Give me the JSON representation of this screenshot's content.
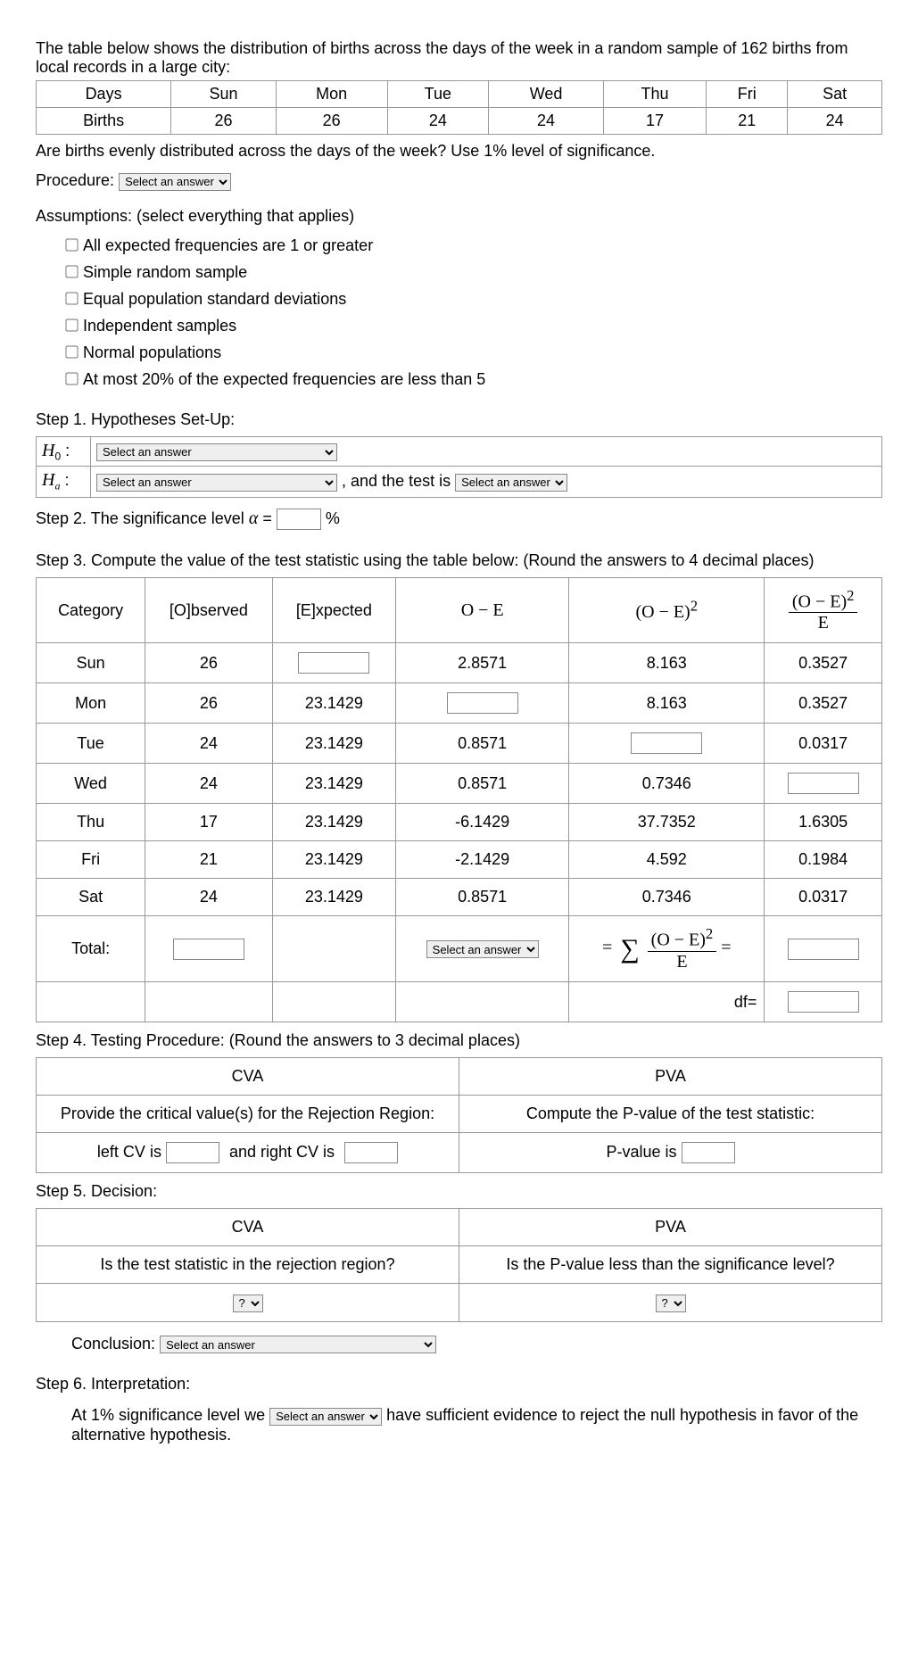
{
  "intro": "The table below shows the distribution of births across the days of the week in a random sample of 162 births from local records in a large city:",
  "data_table": {
    "row1": [
      "Days",
      "Sun",
      "Mon",
      "Tue",
      "Wed",
      "Thu",
      "Fri",
      "Sat"
    ],
    "row2": [
      "Births",
      "26",
      "26",
      "24",
      "24",
      "17",
      "21",
      "24"
    ]
  },
  "question": "Are births evenly distributed across the days of the week? Use 1% level of significance.",
  "procedure_label": "Procedure:",
  "select_placeholder": "Select an answer",
  "assumptions_label": "Assumptions: (select everything that applies)",
  "assumptions": [
    "All expected frequencies are 1 or greater",
    "Simple random sample",
    "Equal population standard deviations",
    "Independent samples",
    "Normal populations",
    "At most 20% of the expected frequencies are less than 5"
  ],
  "step1_title": "Step 1. Hypotheses Set-Up:",
  "h0_label": "H",
  "h0_sub": "0",
  "ha_sub": "a",
  "colon": ":",
  "ha_tail": ", and the test is",
  "step2_prefix": "Step 2. The significance level",
  "alpha": "α",
  "equals": "=",
  "percent": "%",
  "step3_title": "Step 3. Compute the value of the test statistic using the table below: (Round the answers to 4 decimal places)",
  "calc_headers": {
    "cat": "Category",
    "obs": "[O]bserved",
    "exp": "[E]xpected",
    "ome": "O − E",
    "omesq_num": "(O − E)",
    "sq": "2",
    "E": "E"
  },
  "calc_rows": [
    {
      "cat": "Sun",
      "obs": "26",
      "exp_input": true,
      "ome": "2.8571",
      "omesq": "8.163",
      "chi": "0.3527"
    },
    {
      "cat": "Mon",
      "obs": "26",
      "exp": "23.1429",
      "ome_input": true,
      "omesq": "8.163",
      "chi": "0.3527"
    },
    {
      "cat": "Tue",
      "obs": "24",
      "exp": "23.1429",
      "ome": "0.8571",
      "omesq_input": true,
      "chi": "0.0317"
    },
    {
      "cat": "Wed",
      "obs": "24",
      "exp": "23.1429",
      "ome": "0.8571",
      "omesq": "0.7346",
      "chi_input": true
    },
    {
      "cat": "Thu",
      "obs": "17",
      "exp": "23.1429",
      "ome": "-6.1429",
      "omesq": "37.7352",
      "chi": "1.6305"
    },
    {
      "cat": "Fri",
      "obs": "21",
      "exp": "23.1429",
      "ome": "-2.1429",
      "omesq": "4.592",
      "chi": "0.1984"
    },
    {
      "cat": "Sat",
      "obs": "24",
      "exp": "23.1429",
      "ome": "0.8571",
      "omesq": "0.7346",
      "chi": "0.0317"
    }
  ],
  "total_label": "Total:",
  "df_label": "df=",
  "step4_title": "Step 4. Testing Procedure: (Round the answers to 3 decimal places)",
  "cva": "CVA",
  "pva": "PVA",
  "cva_desc": "Provide the critical value(s) for the Rejection Region:",
  "pva_desc": "Compute the P-value of the test statistic:",
  "left_cv": "left CV is",
  "right_cv": "and right CV is",
  "pvalue_is": "P-value is",
  "step5_title": "Step 5. Decision:",
  "cva_q": "Is the test statistic in the rejection region?",
  "pva_q": "Is the P-value less than the significance level?",
  "qmark": "?",
  "conclusion_label": "Conclusion:",
  "step6_title": "Step 6. Interpretation:",
  "interp_prefix": "At 1% significance level we",
  "interp_suffix": "have sufficient evidence to reject the null hypothesis in favor of the alternative hypothesis."
}
